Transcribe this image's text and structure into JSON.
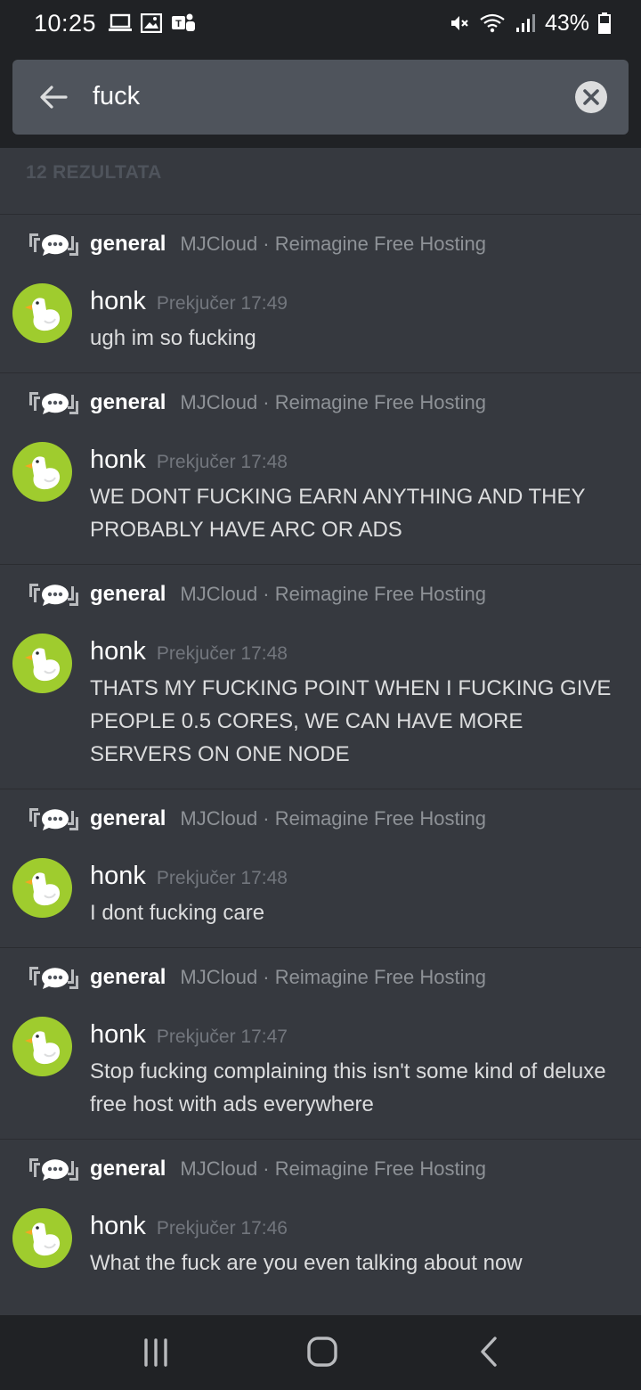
{
  "status_bar": {
    "time": "10:25",
    "battery": "43%",
    "icons": [
      "laptop-icon",
      "image-icon",
      "teams-icon",
      "mute-icon",
      "wifi-icon",
      "signal-icon",
      "battery-icon"
    ]
  },
  "search": {
    "query": "fuck"
  },
  "results_count": "12 REZULTATA",
  "colors": {
    "accent": "#9fcc2e",
    "background": "#36393f",
    "header": "#202225"
  },
  "results": [
    {
      "channel": "general",
      "server": "MJCloud · Reimagine Free Hosting",
      "author": "honk",
      "timestamp": "Prekjučer 17:49",
      "text": "ugh im so fucking"
    },
    {
      "channel": "general",
      "server": "MJCloud · Reimagine Free Hosting",
      "author": "honk",
      "timestamp": "Prekjučer 17:48",
      "text": "WE DONT FUCKING EARN ANYTHING AND THEY PROBABLY HAVE ARC OR ADS"
    },
    {
      "channel": "general",
      "server": "MJCloud · Reimagine Free Hosting",
      "author": "honk",
      "timestamp": "Prekjučer 17:48",
      "text": "THATS MY FUCKING POINT WHEN I FUCKING GIVE PEOPLE 0.5 CORES, WE CAN HAVE MORE SERVERS ON ONE NODE"
    },
    {
      "channel": "general",
      "server": "MJCloud · Reimagine Free Hosting",
      "author": "honk",
      "timestamp": "Prekjučer 17:48",
      "text": "I dont fucking care"
    },
    {
      "channel": "general",
      "server": "MJCloud · Reimagine Free Hosting",
      "author": "honk",
      "timestamp": "Prekjučer 17:47",
      "text": "Stop fucking complaining this isn't some kind of deluxe free host with ads everywhere"
    },
    {
      "channel": "general",
      "server": "MJCloud · Reimagine Free Hosting",
      "author": "honk",
      "timestamp": "Prekjučer 17:46",
      "text": "What the fuck are you even talking about now"
    }
  ]
}
